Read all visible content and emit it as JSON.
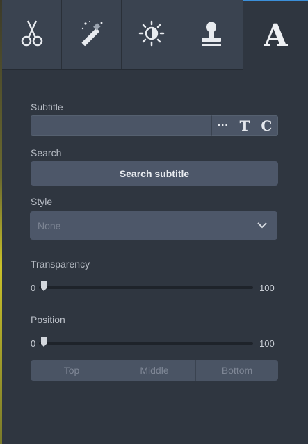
{
  "toolbar": {
    "tools": [
      {
        "icon": "scissors-icon"
      },
      {
        "icon": "magic-wand-icon"
      },
      {
        "icon": "brightness-icon"
      },
      {
        "icon": "stamp-icon"
      }
    ],
    "active_tool": {
      "icon": "text-a-icon",
      "glyph": "A"
    }
  },
  "subtitle": {
    "label": "Subtitle",
    "value": "",
    "buttons": {
      "more": "···",
      "text": "T",
      "caption": "C"
    }
  },
  "search": {
    "label": "Search",
    "button_label": "Search subtitle"
  },
  "style": {
    "label": "Style",
    "selected": "None"
  },
  "transparency": {
    "label": "Transparency",
    "min": "0",
    "max": "100",
    "value": 0
  },
  "position": {
    "label": "Position",
    "min": "0",
    "max": "100",
    "value": 0,
    "options": [
      "Top",
      "Middle",
      "Bottom"
    ]
  },
  "colors": {
    "panel_bg": "#2f3640",
    "toolbar_bg": "#3a4350",
    "control_bg": "#4d5769",
    "accent": "#3b8fd9"
  }
}
